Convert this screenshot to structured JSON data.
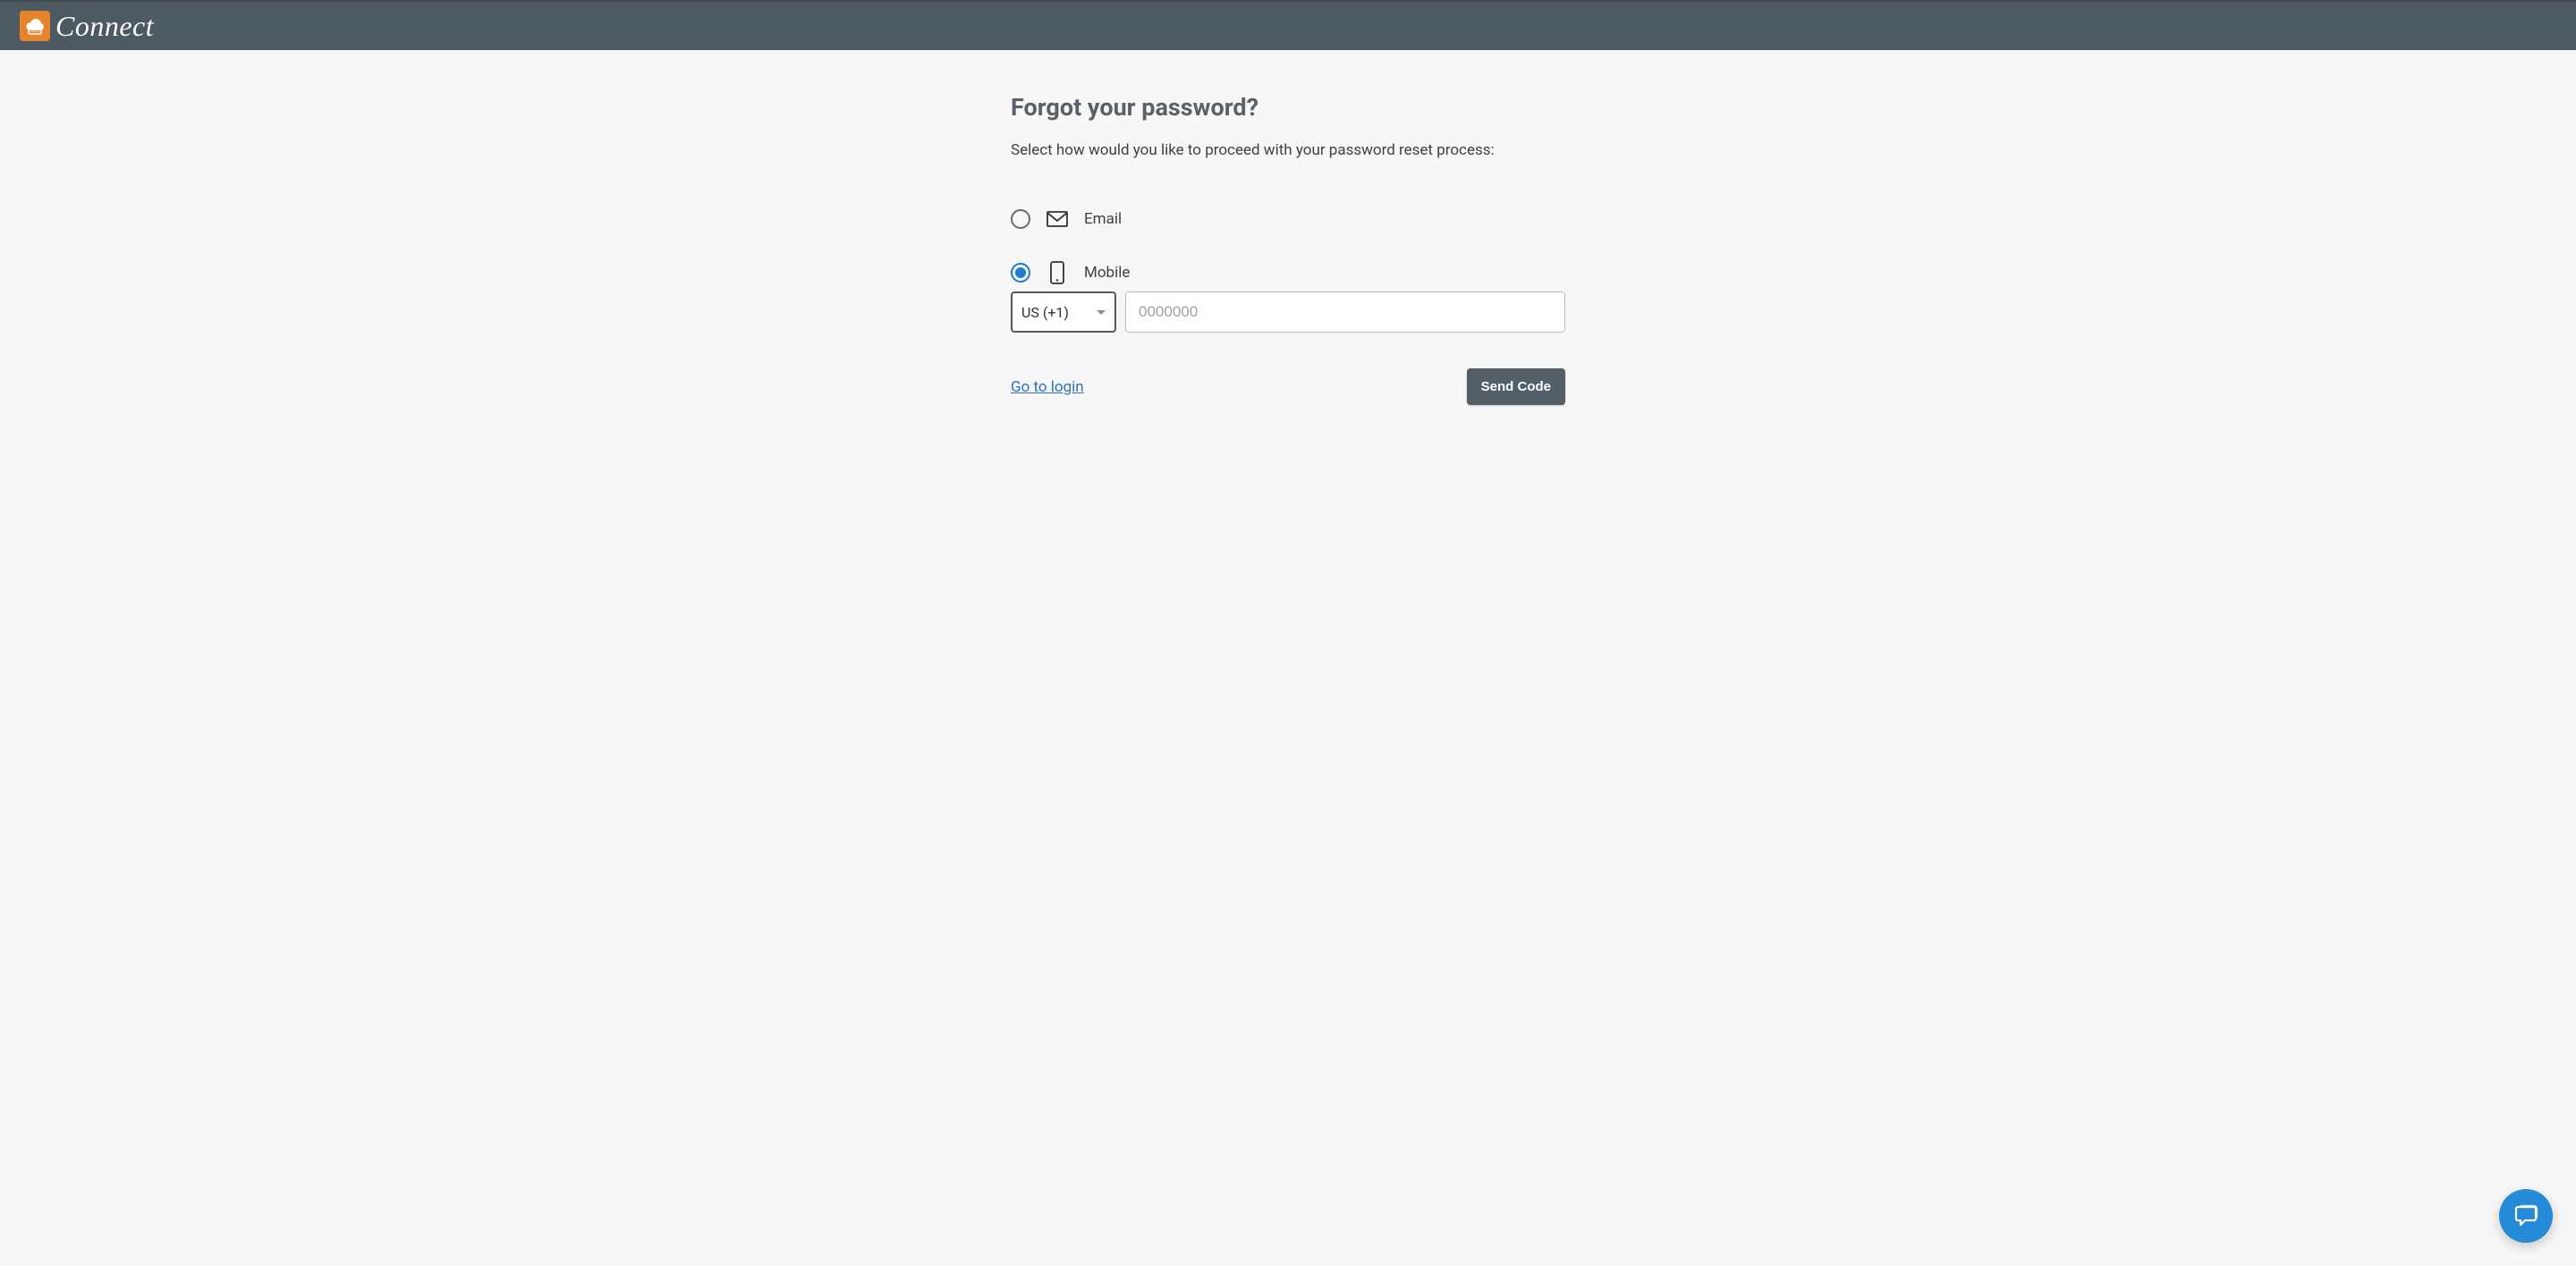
{
  "header": {
    "brand": "Connect"
  },
  "page": {
    "title": "Forgot your password?",
    "subtitle": "Select how would you like to proceed with your password reset process:"
  },
  "options": {
    "email": {
      "label": "Email",
      "selected": false
    },
    "mobile": {
      "label": "Mobile",
      "selected": true,
      "country": "US (+1)",
      "phone_placeholder": "0000000",
      "phone_value": ""
    }
  },
  "actions": {
    "login_link": "Go to login",
    "send_button": "Send Code"
  }
}
